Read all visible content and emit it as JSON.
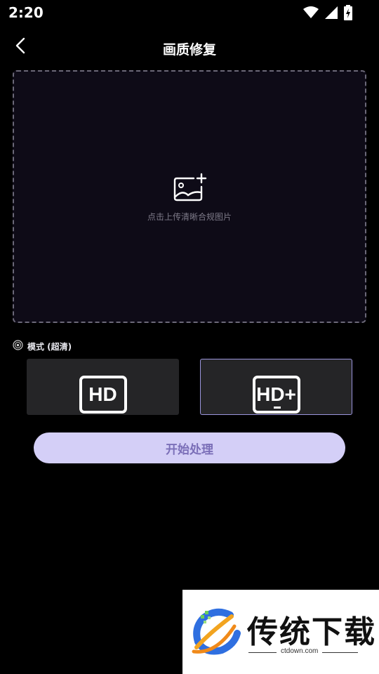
{
  "status_bar": {
    "time": "2:20",
    "icons": [
      "wifi-icon",
      "signal-icon",
      "battery-icon"
    ]
  },
  "header": {
    "title": "画质修复",
    "back_icon": "chevron-left-icon"
  },
  "upload": {
    "hint": "点击上传清晰合规图片",
    "icon": "image-add-icon"
  },
  "mode": {
    "label": "模式 (超清)",
    "icon": "mode-icon",
    "options": [
      {
        "label": "HD",
        "selected": false
      },
      {
        "label": "HD+",
        "selected": true
      }
    ]
  },
  "start_button": {
    "label": "开始处理"
  },
  "watermark": {
    "brand": "传统下载",
    "url": "ctdown.com"
  },
  "colors": {
    "background": "#000000",
    "upload_bg": "#0e0b17",
    "card_bg": "#252527",
    "selected_border": "#9b95dd",
    "button_bg": "#d4cff7",
    "button_text": "#7b6fb8"
  }
}
